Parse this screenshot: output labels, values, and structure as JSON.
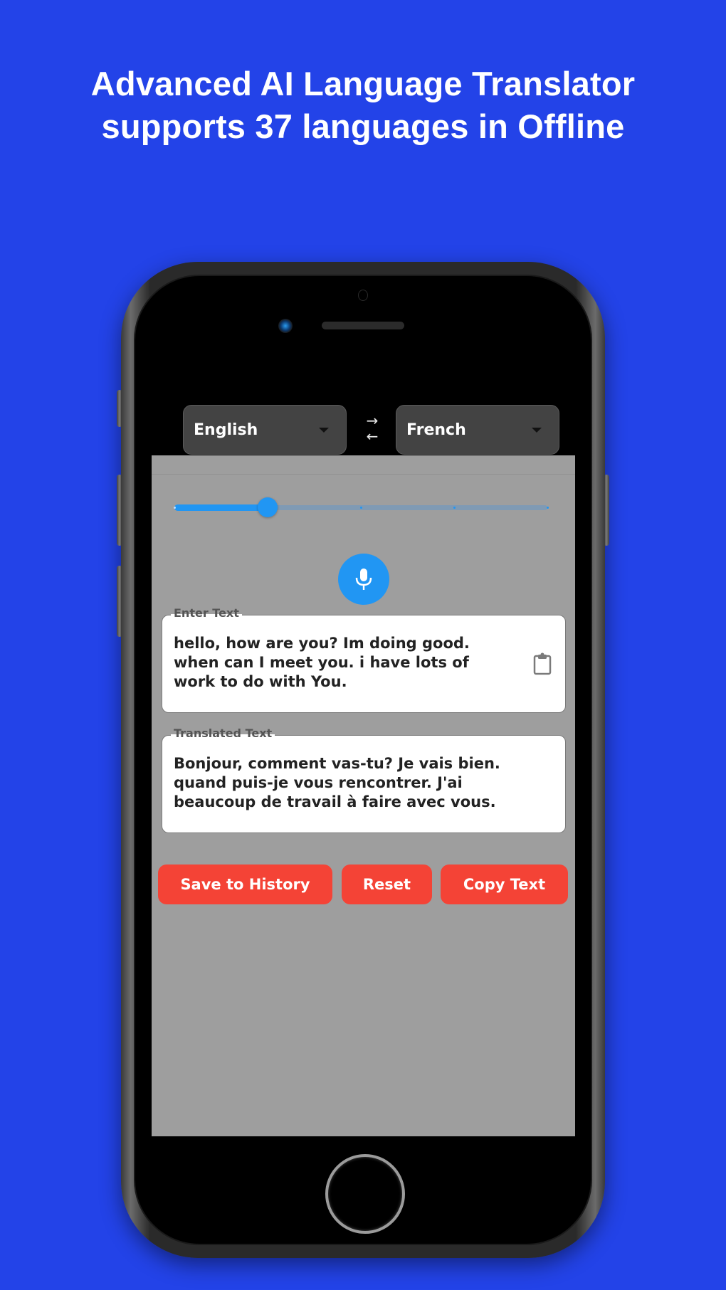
{
  "headline": {
    "line1": "Advanced AI Language Translator",
    "line2": "supports 37 languages in Offline"
  },
  "app": {
    "source_language": "English",
    "target_language": "French",
    "swap_icon": "swap-arrows-icon",
    "swap_glyph_top": "→",
    "swap_glyph_bottom": "←",
    "slider": {
      "value_fraction": 0.25,
      "divisions": 4
    },
    "mic_icon": "microphone-icon",
    "input": {
      "label": "Enter Text",
      "value": "hello, how are you? Im doing good. when can I meet you. i have lots of work to do with You.",
      "paste_icon": "clipboard-icon"
    },
    "output": {
      "label": "Translated Text",
      "value": "Bonjour, comment vas-tu? Je vais bien. quand puis-je vous rencontrer. J'ai beaucoup de travail à faire avec vous."
    },
    "buttons": {
      "save": "Save to History",
      "reset": "Reset",
      "copy": "Copy Text"
    }
  },
  "colors": {
    "background": "#2343e8",
    "accent": "#2196f3",
    "button": "#f44336",
    "screen": "#9e9e9e",
    "dropdown": "#434343"
  }
}
